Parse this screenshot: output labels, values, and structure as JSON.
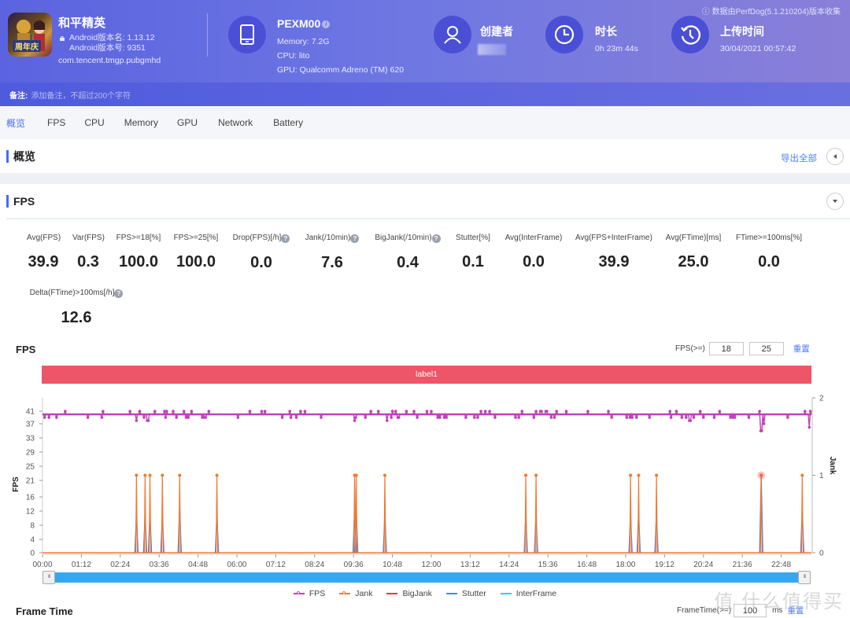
{
  "header": {
    "app": {
      "name": "和平精英",
      "android_version_name": "Android版本名: 1.13.12",
      "android_version_code": "Android版本号: 9351",
      "package": "com.tencent.tmgp.pubgmhd",
      "icon_badge": "周年庆",
      "icon": "game-app-icon"
    },
    "device": {
      "model": "PEXM00",
      "memory": "Memory: 7.2G",
      "cpu": "CPU: lito",
      "gpu": "GPU: Qualcomm Adreno (TM) 620",
      "icon": "phone-icon"
    },
    "creator": {
      "title": "创建者",
      "icon": "user-icon"
    },
    "duration": {
      "title": "时长",
      "value": "0h 23m 44s",
      "icon": "clock-icon"
    },
    "upload": {
      "title": "上传时间",
      "value": "30/04/2021 00:57:42",
      "icon": "history-icon"
    },
    "collected_by": "数据由PerfDog(5.1.210204)版本收集"
  },
  "note": {
    "label": "备注:",
    "placeholder": "添加备注，不超过200个字符"
  },
  "tabs": [
    {
      "label": "概览",
      "active": true
    },
    {
      "label": "FPS"
    },
    {
      "label": "CPU"
    },
    {
      "label": "Memory"
    },
    {
      "label": "GPU"
    },
    {
      "label": "Network"
    },
    {
      "label": "Battery"
    }
  ],
  "overview": {
    "title": "概览",
    "export_label": "导出全部"
  },
  "fps_section": {
    "title": "FPS",
    "metrics": [
      {
        "key": "Avg(FPS)",
        "value": "39.9"
      },
      {
        "key": "Var(FPS)",
        "value": "0.3"
      },
      {
        "key": "FPS>=18[%]",
        "value": "100.0"
      },
      {
        "key": "FPS>=25[%]",
        "value": "100.0"
      },
      {
        "key": "Drop(FPS)[/h]",
        "value": "0.0",
        "help": true
      },
      {
        "key": "Jank(/10min)",
        "value": "7.6",
        "help": true
      },
      {
        "key": "BigJank(/10min)",
        "value": "0.4",
        "help": true
      },
      {
        "key": "Stutter[%]",
        "value": "0.1"
      },
      {
        "key": "Avg(InterFrame)",
        "value": "0.0"
      },
      {
        "key": "Avg(FPS+InterFrame)",
        "value": "39.9"
      },
      {
        "key": "Avg(FTime)[ms]",
        "value": "25.0"
      },
      {
        "key": "FTime>=100ms[%]",
        "value": "0.0"
      },
      {
        "key": "Delta(FTime)>100ms[/h]",
        "value": "12.6",
        "help": true
      }
    ],
    "chart_title": "FPS",
    "fps_threshold_label": "FPS(>=)",
    "fps_threshold_1": "18",
    "fps_threshold_2": "25",
    "reset_label": "重置",
    "label_bar": "label1"
  },
  "chart_data": {
    "type": "line",
    "title": "FPS",
    "xlabel": "",
    "ylabel": "FPS",
    "y2label": "Jank",
    "x_range_seconds": [
      0,
      1424
    ],
    "ylim": [
      0,
      43
    ],
    "y_ticks": [
      0,
      4,
      8,
      12,
      16,
      21,
      25,
      29,
      33,
      37,
      41
    ],
    "y2lim": [
      0,
      2
    ],
    "y2_ticks": [
      0,
      1,
      2
    ],
    "x_ticks": [
      "00:00",
      "01:12",
      "02:24",
      "03:36",
      "04:48",
      "06:00",
      "07:12",
      "08:24",
      "09:36",
      "10:48",
      "12:00",
      "13:12",
      "14:24",
      "15:36",
      "16:48",
      "18:00",
      "19:12",
      "20:24",
      "21:36",
      "22:48"
    ],
    "legend": [
      "FPS",
      "Jank",
      "BigJank",
      "Stutter",
      "InterFrame"
    ],
    "legend_position": "bottom",
    "series": [
      {
        "name": "FPS",
        "color": "#c040b8",
        "baseline": 40,
        "typical_range": [
          39,
          41
        ],
        "dips": [
          {
            "t": 174,
            "v": 38
          },
          {
            "t": 195,
            "v": 38
          },
          {
            "t": 578,
            "v": 38
          },
          {
            "t": 638,
            "v": 38
          },
          {
            "t": 1199,
            "v": 38
          },
          {
            "t": 1331,
            "v": 35
          },
          {
            "t": 1336,
            "v": 37
          },
          {
            "t": 1420,
            "v": 36
          }
        ]
      },
      {
        "name": "Jank",
        "color": "#f07830",
        "events_seconds": [
          174,
          190,
          199,
          222,
          254,
          323,
          578,
          581,
          634,
          895,
          914,
          1089,
          1104,
          1137,
          1331,
          1407
        ],
        "event_value": 1
      },
      {
        "name": "BigJank",
        "color": "#e83838",
        "events_seconds": [
          1331
        ],
        "event_value": 1
      },
      {
        "name": "Stutter",
        "color": "#4a84e8",
        "events_seconds": [
          174,
          190,
          199,
          222,
          254,
          323,
          578,
          581,
          634,
          895,
          914,
          1089,
          1104,
          1137,
          1331,
          1407
        ],
        "event_values": [
          0.5,
          0.5,
          0.5,
          0.5,
          0.6,
          0.5,
          0.55,
          0.55,
          0.5,
          0.5,
          0.5,
          0.5,
          0.5,
          0.5,
          1,
          0.55
        ]
      },
      {
        "name": "InterFrame",
        "color": "#30d0d8",
        "values_constant": 0
      }
    ]
  },
  "frame_time": {
    "title": "Frame Time",
    "threshold_label": "FrameTime(>=)",
    "threshold_value": "100",
    "unit": "ms",
    "reset_label": "重置"
  },
  "watermark": "值 什么值得买"
}
